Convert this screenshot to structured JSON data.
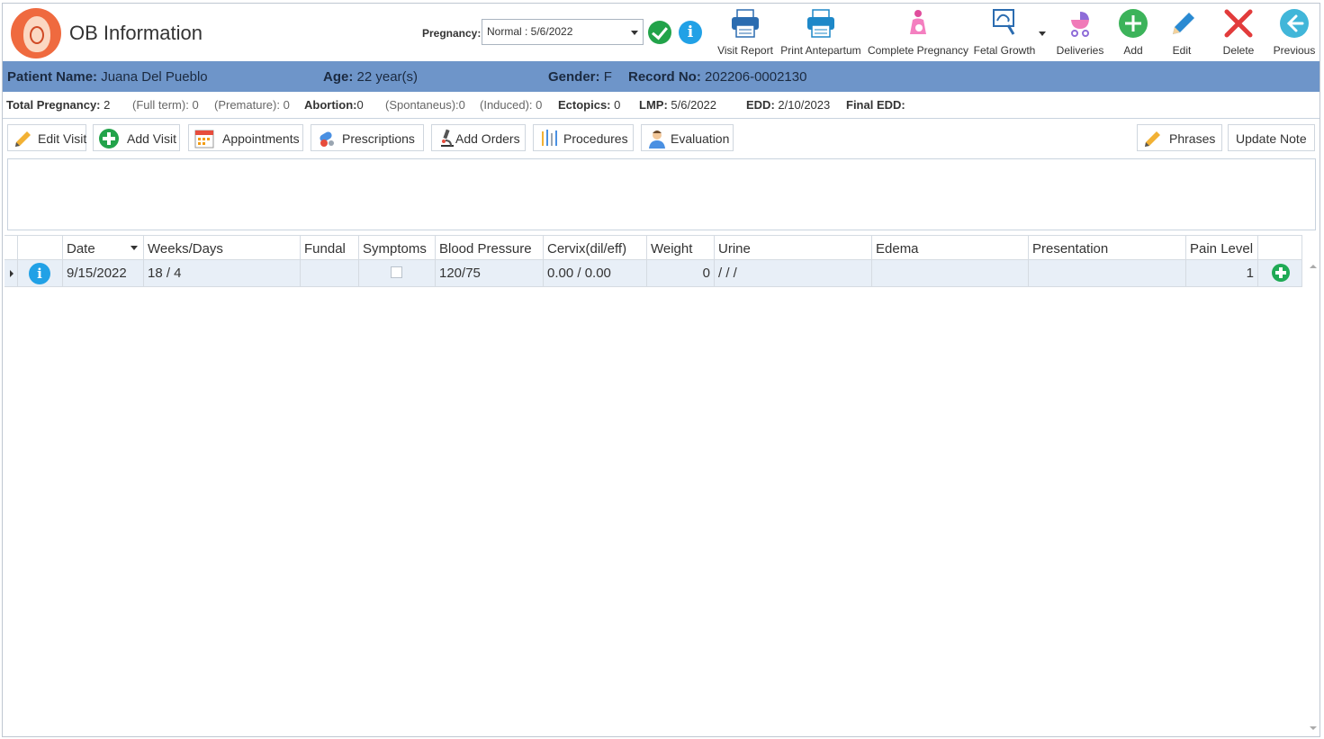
{
  "app": {
    "title": "OB Information"
  },
  "pregnancy": {
    "label": "Pregnancy:",
    "selected": "Normal : 5/6/2022"
  },
  "toolbar": {
    "visit_report": "Visit Report",
    "print_antepartum": "Print Antepartum",
    "complete_pregnancy": "Complete Pregnancy",
    "fetal_growth": "Fetal Growth",
    "deliveries": "Deliveries",
    "add": "Add",
    "edit": "Edit",
    "delete": "Delete",
    "previous": "Previous"
  },
  "patient": {
    "name_label": "Patient Name:",
    "name": "Juana Del Pueblo",
    "age_label": "Age:",
    "age": "22 year(s)",
    "gender_label": "Gender:",
    "gender": "F",
    "record_label": "Record No:",
    "record": "202206-0002130"
  },
  "summary": {
    "total_label": "Total Pregnancy:",
    "total": "2",
    "fullterm": "(Full term): 0",
    "premature": "(Premature): 0",
    "abortion_label": "Abortion:",
    "abortion": "0",
    "spontaneus": "(Spontaneus):0",
    "induced": "(Induced): 0",
    "ectopics_label": "Ectopics:",
    "ectopics": "0",
    "lmp_label": "LMP:",
    "lmp": "5/6/2022",
    "edd_label": "EDD:",
    "edd": "2/10/2023",
    "final_edd_label": "Final EDD:"
  },
  "actions": {
    "edit_visit": "Edit Visit",
    "add_visit": "Add Visit",
    "appointments": "Appointments",
    "prescriptions": "Prescriptions",
    "add_orders": "Add Orders",
    "procedures": "Procedures",
    "evaluation": "Evaluation",
    "phrases": "Phrases",
    "update_note": "Update Note"
  },
  "grid": {
    "columns": [
      "Date",
      "Weeks/Days",
      "Fundal",
      "Symptoms",
      "Blood Pressure",
      "Cervix(dil/eff)",
      "Weight",
      "Urine",
      "Edema",
      "Presentation",
      "Pain Level"
    ],
    "rows": [
      {
        "date": "9/15/2022",
        "weeks": "18 / 4",
        "fundal": "",
        "bp": "120/75",
        "cervix": "0.00 / 0.00",
        "weight": "0",
        "urine": "/ / /",
        "edema": "",
        "presentation": "",
        "pain": "1"
      }
    ]
  },
  "colors": {
    "patient_bar": "#6e95c9",
    "row_highlight": "#e8eff7",
    "accent_green": "#22a34a",
    "accent_blue": "#21a1e6"
  }
}
